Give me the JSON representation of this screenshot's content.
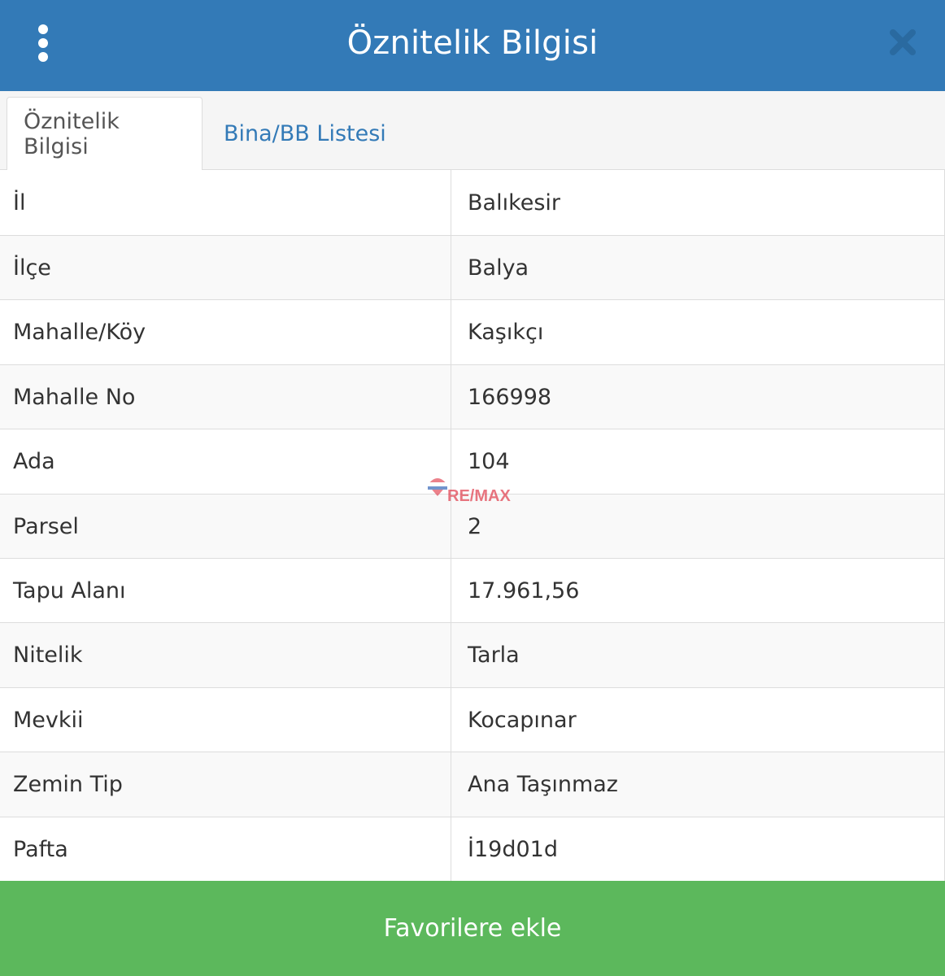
{
  "header": {
    "title": "Öznitelik Bilgisi",
    "menu_icon": "vertical-ellipsis-icon",
    "close_icon": "close-icon"
  },
  "tabs": [
    {
      "label": "Öznitelik Bilgisi",
      "active": true
    },
    {
      "label": "Bina/BB Listesi",
      "active": false
    }
  ],
  "attributes": [
    {
      "key": "İl",
      "value": "Balıkesir"
    },
    {
      "key": "İlçe",
      "value": "Balya"
    },
    {
      "key": "Mahalle/Köy",
      "value": "Kaşıkçı"
    },
    {
      "key": "Mahalle No",
      "value": "166998"
    },
    {
      "key": "Ada",
      "value": "104"
    },
    {
      "key": "Parsel",
      "value": "2"
    },
    {
      "key": "Tapu Alanı",
      "value": "17.961,56"
    },
    {
      "key": "Nitelik",
      "value": "Tarla"
    },
    {
      "key": "Mevkii",
      "value": "Kocapınar"
    },
    {
      "key": "Zemin Tip",
      "value": "Ana Taşınmaz"
    },
    {
      "key": "Pafta",
      "value": "İ19d01d"
    }
  ],
  "watermark": {
    "text": "RE/MAX"
  },
  "footer": {
    "button_label": "Favorilere ekle"
  },
  "colors": {
    "header_bg": "#337ab7",
    "tab_link": "#337ab7",
    "footer_bg": "#5cb85c",
    "watermark_red": "#dc1c2e",
    "watermark_blue": "#003da5"
  }
}
